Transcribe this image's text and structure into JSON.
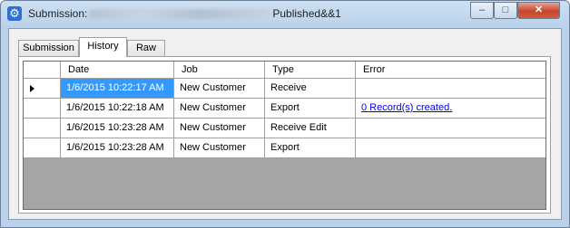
{
  "window": {
    "title_prefix": "Submission:",
    "title_suffix": "Published&&1",
    "controls": {
      "minimize": "–",
      "maximize": "□",
      "close": "✕"
    }
  },
  "tabs": [
    {
      "label": "Submission",
      "selected": false
    },
    {
      "label": "History",
      "selected": true
    },
    {
      "label": "Raw",
      "selected": false
    }
  ],
  "grid": {
    "columns": [
      "Date",
      "Job",
      "Type",
      "Error"
    ],
    "rows": [
      {
        "date": "1/6/2015 10:22:17 AM",
        "job": "New Customer",
        "type": "Receive",
        "error": "",
        "selected": true
      },
      {
        "date": "1/6/2015 10:22:18 AM",
        "job": "New Customer",
        "type": "Export",
        "error": "0 Record(s) created.",
        "selected": false
      },
      {
        "date": "1/6/2015 10:23:28 AM",
        "job": "New Customer",
        "type": "Receive Edit",
        "error": "",
        "selected": false
      },
      {
        "date": "1/6/2015 10:23:28 AM",
        "job": "New Customer",
        "type": "Export",
        "error": "",
        "selected": false
      }
    ]
  },
  "colors": {
    "selection": "#3399ff",
    "grid_background": "#a5a5a5",
    "link": "#0000ee"
  }
}
